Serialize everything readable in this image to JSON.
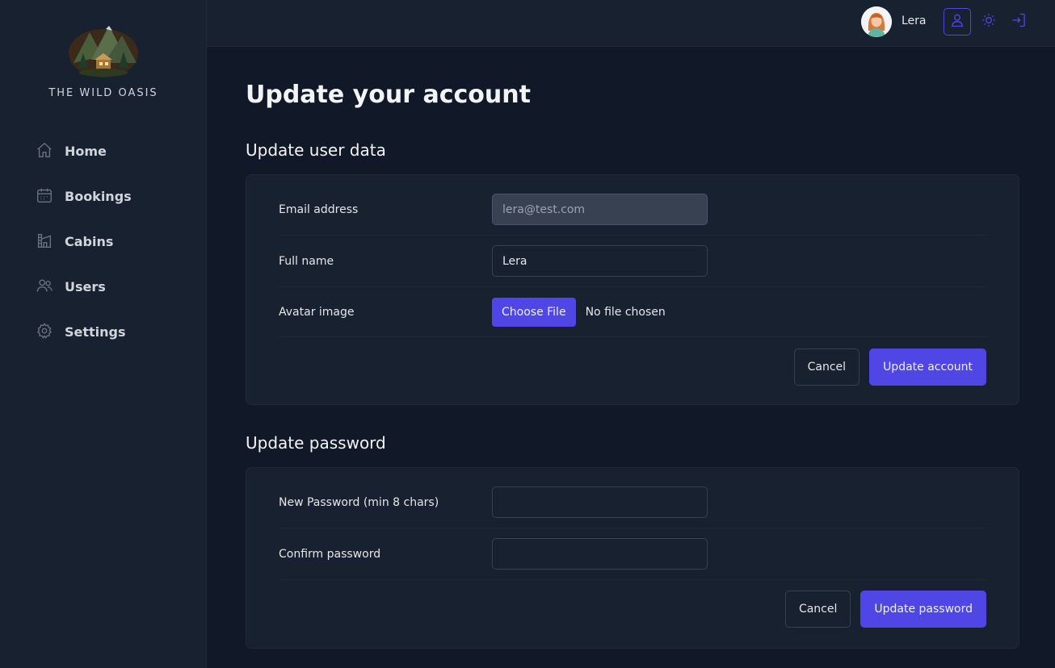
{
  "brand": {
    "name": "THE WILD OASIS"
  },
  "sidebar": {
    "items": [
      {
        "label": "Home",
        "icon": "home-icon"
      },
      {
        "label": "Bookings",
        "icon": "calendar-icon"
      },
      {
        "label": "Cabins",
        "icon": "cabin-icon"
      },
      {
        "label": "Users",
        "icon": "users-icon"
      },
      {
        "label": "Settings",
        "icon": "gear-icon"
      }
    ]
  },
  "header": {
    "user_name": "Lera",
    "buttons": [
      "user-icon",
      "sun-icon",
      "logout-icon"
    ]
  },
  "page": {
    "title": "Update your account"
  },
  "user_data": {
    "title": "Update user data",
    "email_label": "Email address",
    "email_value": "lera@test.com",
    "fullname_label": "Full name",
    "fullname_value": "Lera",
    "avatar_label": "Avatar image",
    "choose_file_label": "Choose File",
    "no_file_text": "No file chosen",
    "cancel_label": "Cancel",
    "submit_label": "Update account"
  },
  "password": {
    "title": "Update password",
    "new_label": "New Password (min 8 chars)",
    "new_value": "",
    "confirm_label": "Confirm password",
    "confirm_value": "",
    "cancel_label": "Cancel",
    "submit_label": "Update password"
  },
  "colors": {
    "accent": "#4f46e5",
    "background": "#111827",
    "panel": "#18212f"
  }
}
